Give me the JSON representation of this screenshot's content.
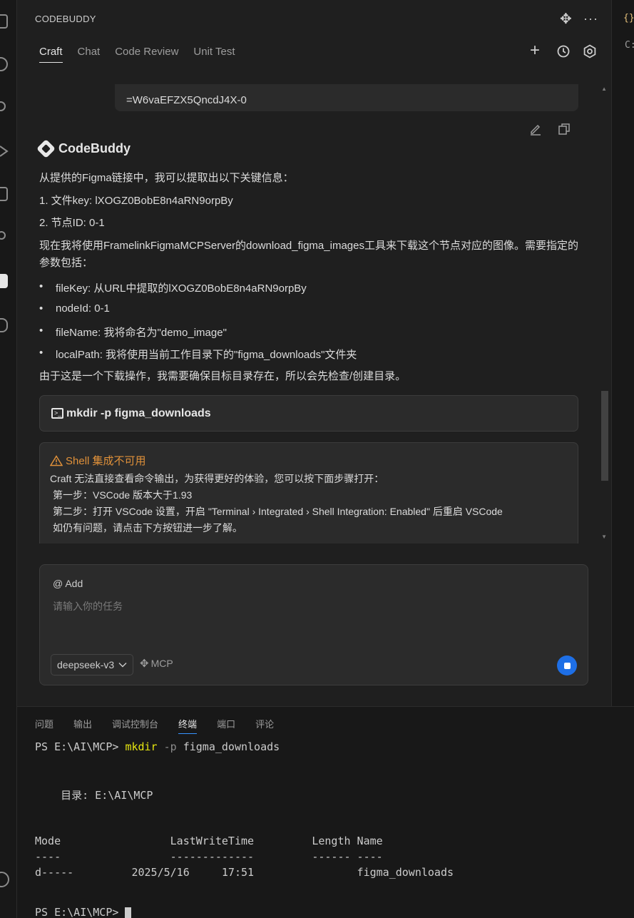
{
  "panel": {
    "title": "CODEBUDDY",
    "tabs": [
      "Craft",
      "Chat",
      "Code Review",
      "Unit Test"
    ]
  },
  "conversation": {
    "user_message_tail": "=W6vaEFZX5QncdJ4X-0",
    "assistant_name": "CodeBuddy",
    "lines": {
      "intro": "从提供的Figma链接中，我可以提取出以下关键信息：",
      "item1": "1. 文件key: lXOGZ0BobE8n4aRN9orpBy",
      "item2": "2. 节点ID: 0-1",
      "plan": "现在我将使用FramelinkFigmaMCPServer的download_figma_images工具来下载这个节点对应的图像。需要指定的参数包括：",
      "bullets": [
        "fileKey: 从URL中提取的lXOGZ0BobE8n4aRN9orpBy",
        "nodeId: 0-1",
        "fileName: 我将命名为\"demo_image\"",
        "localPath: 我将使用当前工作目录下的\"figma_downloads\"文件夹"
      ],
      "note": "由于这是一个下载操作，我需要确保目标目录存在，所以会先检查/创建目录。"
    },
    "command": "mkdir -p figma_downloads",
    "warning": {
      "title": "Shell 集成不可用",
      "lines": [
        "Craft 无法直接查看命令输出，为获得更好的体验，您可以按下面步骤打开：",
        "第一步：VSCode 版本大于1.93",
        "第二步：打开 VSCode 设置，开启 \"Terminal › Integrated › Shell Integration: Enabled\" 后重启 VSCode",
        "如仍有问题，请点击下方按钮进一步了解。"
      ]
    }
  },
  "input": {
    "add_label": "@ Add",
    "placeholder": "请输入你的任务",
    "model": "deepseek-v3",
    "mcp_label": "MCP"
  },
  "editor_strip": {
    "brace": "{}",
    "letter": "C:"
  },
  "terminal": {
    "tabs": [
      "问题",
      "输出",
      "调试控制台",
      "终端",
      "端口",
      "评论"
    ],
    "active_tab": "终端",
    "prompt1": "PS E:\\AI\\MCP> ",
    "cmd_word": "mkdir",
    "cmd_flag": " -p",
    "cmd_arg": " figma_downloads",
    "dir_line": "    目录: E:\\AI\\MCP",
    "header_line": "Mode                 LastWriteTime         Length Name",
    "dash_line": "----                 -------------         ------ ----",
    "row_line": "d-----         2025/5/16     17:51                figma_downloads",
    "prompt2": "PS E:\\AI\\MCP> "
  },
  "colors": {
    "accent_blue": "#1e6fe6",
    "warning_orange": "#e0913a",
    "terminal_command_yellow": "#e5e510"
  }
}
